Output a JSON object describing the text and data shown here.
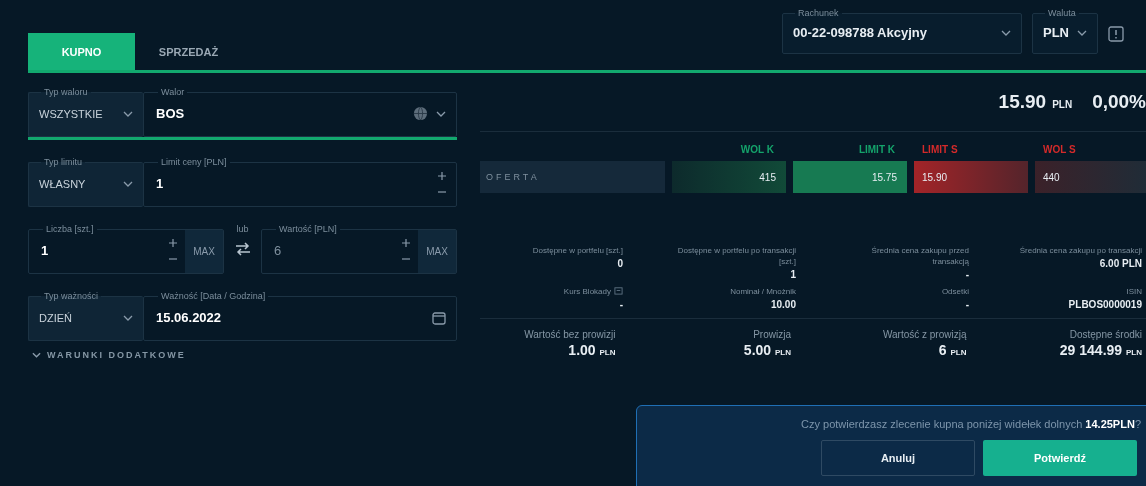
{
  "tabs": [
    {
      "label": "KUPNO",
      "selected": true
    },
    {
      "label": "SPRZEDAŻ",
      "selected": false
    }
  ],
  "account": {
    "label": "Rachunek",
    "value": "00-22-098788 Akcyjny"
  },
  "currency": {
    "label": "Waluta",
    "value": "PLN"
  },
  "instrument": {
    "type_label": "Typ waloru",
    "type_value": "WSZYSTKIE",
    "label": "Walor",
    "value": "BOS"
  },
  "limit": {
    "type_label": "Typ limitu",
    "type_value": "WŁASNY",
    "label": "Limit ceny [PLN]",
    "value": "1"
  },
  "quantity": {
    "label": "Liczba [szt.]",
    "value": "1",
    "max": "MAX"
  },
  "or_label": "lub",
  "amount": {
    "label": "Wartość [PLN]",
    "value": "6",
    "max": "MAX"
  },
  "validity": {
    "type_label": "Typ ważności",
    "type_value": "DZIEŃ",
    "label": "Ważność [Data / Godzina]",
    "value": "15.06.2022"
  },
  "extra_conditions": {
    "label": "WARUNKI DODATKOWE",
    "expanded": false
  },
  "quote": {
    "price": "15.90",
    "unit": "PLN",
    "change": "0,00%"
  },
  "order_book": {
    "row_label": "OFERTA",
    "columns": [
      {
        "label": "WOL K",
        "kind": "buy"
      },
      {
        "label": "LIMIT K",
        "kind": "buy"
      },
      {
        "label": "LIMIT S",
        "kind": "sell"
      },
      {
        "label": "WOL S",
        "kind": "sell"
      }
    ],
    "cells": [
      {
        "value": "415",
        "kind": "buy",
        "best": false
      },
      {
        "value": "15.75",
        "kind": "buy",
        "best": true
      },
      {
        "value": "15.90",
        "kind": "sell",
        "best": true
      },
      {
        "value": "440",
        "kind": "sell",
        "best": false
      }
    ]
  },
  "info": [
    {
      "label": "Dostępne w portfelu [szt.]",
      "value": "0",
      "icon": false
    },
    {
      "label": "Dostępne w portfelu po transakcji [szt.]",
      "value": "1",
      "icon": false
    },
    {
      "label": "Średnia cena zakupu przed transakcją",
      "value": "-",
      "icon": false
    },
    {
      "label": "Średnia cena zakupu po transakcji",
      "value": "6.00 PLN",
      "icon": false
    },
    {
      "label": "Kurs Blokady",
      "value": "-",
      "icon": true
    },
    {
      "label": "Nominał / Mnożnik",
      "value": "10.00",
      "icon": false
    },
    {
      "label": "Odsetki",
      "value": "-",
      "icon": false
    },
    {
      "label": "ISIN",
      "value": "PLBOS0000019",
      "icon": false
    }
  ],
  "summary": [
    {
      "label": "Wartość bez prowizji",
      "amount": "1.00",
      "unit": "PLN"
    },
    {
      "label": "Prowizja",
      "amount": "5.00",
      "unit": "PLN"
    },
    {
      "label": "Wartość z prowizją",
      "amount": "6",
      "unit": "PLN"
    },
    {
      "label": "Dostępne środki",
      "amount": "29 144.99",
      "unit": "PLN"
    }
  ],
  "dialog": {
    "message": "Czy potwierdzasz zlecenie kupna poniżej widełek dolnych **14.25PLN**?",
    "buttons": [
      {
        "label": "Anuluj",
        "kind": "secondary"
      },
      {
        "label": "Potwierdź",
        "kind": "primary"
      }
    ]
  }
}
